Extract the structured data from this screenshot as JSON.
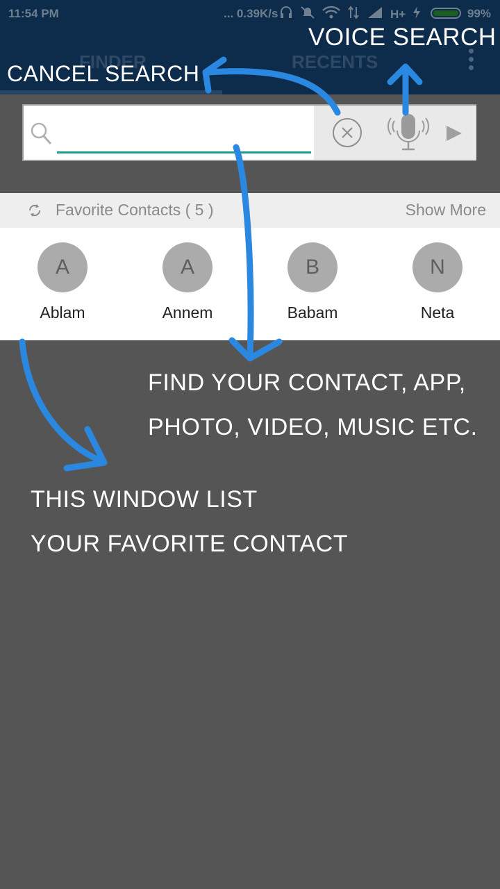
{
  "status_bar": {
    "time": "11:54 PM",
    "network_speed": "... 0.39K/s",
    "network_type": "H+",
    "battery_percent": "99%",
    "battery_level": 0.99
  },
  "tabs": [
    {
      "label": "FINDER",
      "selected": true
    },
    {
      "label": "RECENTS",
      "selected": false
    }
  ],
  "search": {
    "placeholder": "",
    "value": ""
  },
  "favorites": {
    "title": "Favorite Contacts ( 5 )",
    "show_more": "Show More",
    "contacts": [
      {
        "initial": "A",
        "name": "Ablam"
      },
      {
        "initial": "A",
        "name": "Annem"
      },
      {
        "initial": "B",
        "name": "Babam"
      },
      {
        "initial": "N",
        "name": "Neta"
      }
    ]
  },
  "annotations": {
    "cancel_search": "CANCEL SEARCH",
    "voice_search": "VOICE SEARCH",
    "find_line1": "FIND YOUR CONTACT, APP,",
    "find_line2": "PHOTO, VIDEO, MUSIC ETC.",
    "list_line1": "THIS WINDOW LIST",
    "list_line2": "YOUR FAVORITE CONTACT"
  },
  "colors": {
    "app_bar": "#0d2c4b",
    "accent_underline": "#1d9a8f",
    "annotation_arrow": "#2a88e0",
    "background": "#555555"
  },
  "icons": [
    "search-icon",
    "clear-icon",
    "mic-icon",
    "send-icon",
    "refresh-icon",
    "overflow-menu-icon"
  ]
}
